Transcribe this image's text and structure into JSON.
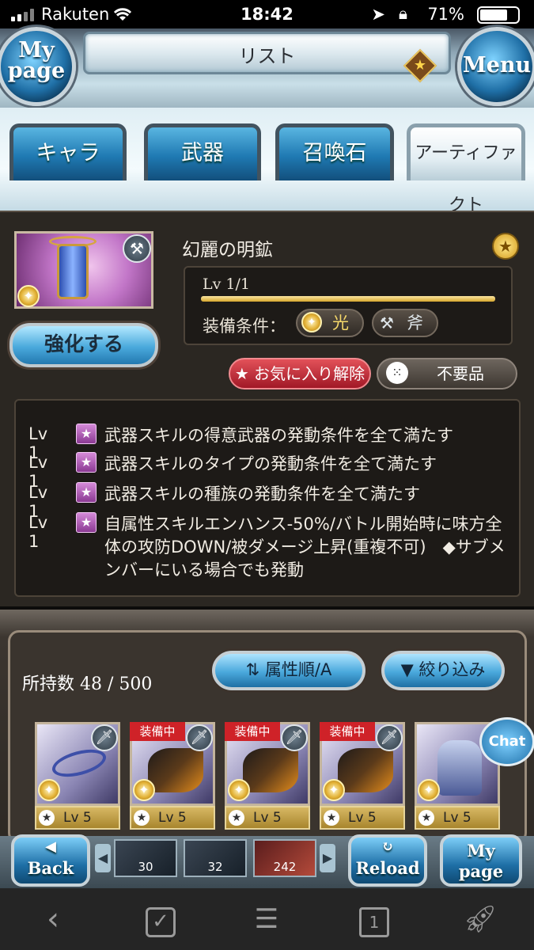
{
  "status_bar": {
    "carrier": "Rakuten",
    "time": "18:42",
    "battery": "71%"
  },
  "header": {
    "title": "リスト",
    "mypage_label": "My page",
    "menu_label": "Menu"
  },
  "tabs": [
    {
      "label": "キャラ"
    },
    {
      "label": "武器"
    },
    {
      "label": "召喚石"
    },
    {
      "label": "アーティファクト"
    }
  ],
  "detail": {
    "name": "幻麗の明鉱",
    "level": "Lv 1/1",
    "level_fill": 1.0,
    "equip_label": "装備条件：",
    "element": "光",
    "weapon_type": "斧",
    "enhance_label": "強化する",
    "favorite_label": "お気に入り解除",
    "junk_label": "不要品"
  },
  "skills": [
    {
      "lv": "Lv 1",
      "text": "武器スキルの得意武器の発動条件を全て満たす"
    },
    {
      "lv": "Lv 1",
      "text": "武器スキルのタイプの発動条件を全て満たす"
    },
    {
      "lv": "Lv 1",
      "text": "武器スキルの種族の発動条件を全て満たす"
    },
    {
      "lv": "Lv 1",
      "text": "自属性スキルエンハンス-50%/バトル開始時に味方全体の攻防DOWN/被ダメージ上昇(重複不可)　◆サブメンバーにいる場合でも発動"
    }
  ],
  "inventory": {
    "count": "所持数 48 / 500",
    "sort_label": "属性順/A",
    "filter_label": "絞り込み",
    "chat_label": "Chat",
    "cards": [
      {
        "equipped": "",
        "level": "Lv 5"
      },
      {
        "equipped": "装備中",
        "level": "Lv 5"
      },
      {
        "equipped": "装備中",
        "level": "Lv 5"
      },
      {
        "equipped": "装備中",
        "level": "Lv 5"
      },
      {
        "equipped": "",
        "level": "Lv 5"
      }
    ]
  },
  "footer": {
    "back_label": "Back",
    "reload_label": "Reload",
    "mypage_label": "My page",
    "quick_items": [
      "30",
      "32",
      "242"
    ]
  },
  "browser_bar": {
    "tab_count": "1"
  }
}
